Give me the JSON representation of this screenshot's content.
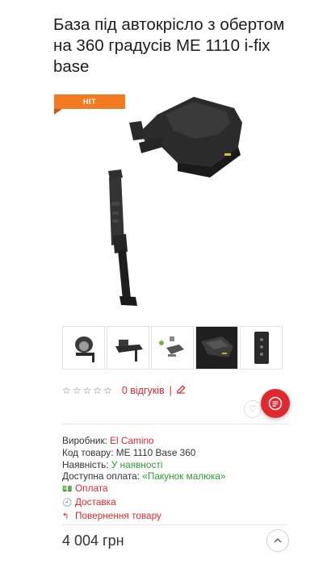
{
  "product": {
    "title": "База під автокрісло з обертом на 360 градусів ME 1110 i-fix base",
    "badge": "HIT",
    "price": "4 004 грн"
  },
  "gallery": {
    "thumbnails": [
      "thumb-car-seat",
      "thumb-base-side",
      "thumb-base-bright",
      "thumb-base-dark",
      "thumb-control-panel"
    ]
  },
  "rating": {
    "stars_filled": 0,
    "stars_total": 5,
    "reviews_label": "0 відгуків",
    "separator": "|"
  },
  "info": {
    "manufacturer_label": "Виробник:",
    "manufacturer_value": "El Camino",
    "code_label": "Код товару:",
    "code_value": "ME 1110 Base 360",
    "availability_label": "Наявність:",
    "availability_value": "У наявності",
    "payment_avail_label": "Доступна оплата:",
    "payment_avail_value": "«Пакунок малюка»",
    "payment_link": "Оплата",
    "delivery_link": "Доставка",
    "return_link": "Повернення товару"
  },
  "colors": {
    "accent": "#e0282e",
    "badge": "#f27b22",
    "in_stock": "#2e9a2e"
  }
}
